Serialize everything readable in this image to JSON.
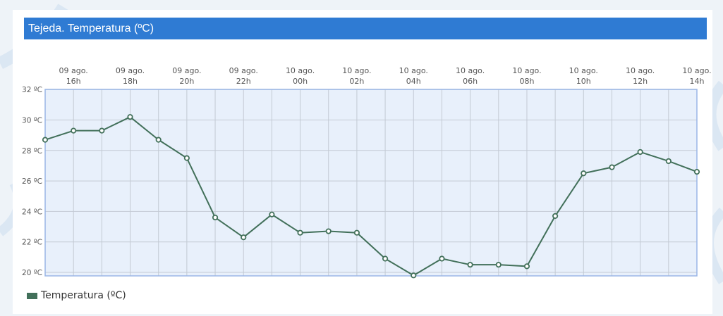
{
  "title": "Tejeda. Temperatura (ºC)",
  "colors": {
    "header": "#2f7bd3",
    "line": "#42705a",
    "plot_bg": "#e8f0fb",
    "plot_border": "#9ab6e6",
    "grid": "#c3cad4"
  },
  "legend": {
    "label": "Temperatura (ºC)"
  },
  "chart_data": {
    "type": "line",
    "x_ticks": [
      [
        "09 ago.",
        "16h"
      ],
      [
        "09 ago.",
        "18h"
      ],
      [
        "09 ago.",
        "20h"
      ],
      [
        "09 ago.",
        "22h"
      ],
      [
        "10 ago.",
        "00h"
      ],
      [
        "10 ago.",
        "02h"
      ],
      [
        "10 ago.",
        "04h"
      ],
      [
        "10 ago.",
        "06h"
      ],
      [
        "10 ago.",
        "08h"
      ],
      [
        "10 ago.",
        "10h"
      ],
      [
        "10 ago.",
        "12h"
      ],
      [
        "10 ago.",
        "14h"
      ]
    ],
    "y_ticks": [
      "20 ºC",
      "22 ºC",
      "24 ºC",
      "26 ºC",
      "28 ºC",
      "30 ºC",
      "32 ºC"
    ],
    "ylim": [
      19.8,
      32
    ],
    "grid": true,
    "legend_position": "bottom-left",
    "series": [
      {
        "name": "Temperatura (ºC)",
        "x": [
          "09 ago. 15h",
          "09 ago. 16h",
          "09 ago. 17h",
          "09 ago. 18h",
          "09 ago. 19h",
          "09 ago. 20h",
          "09 ago. 21h",
          "09 ago. 22h",
          "09 ago. 23h",
          "10 ago. 00h",
          "10 ago. 01h",
          "10 ago. 02h",
          "10 ago. 03h",
          "10 ago. 04h",
          "10 ago. 05h",
          "10 ago. 06h",
          "10 ago. 07h",
          "10 ago. 08h",
          "10 ago. 09h",
          "10 ago. 10h",
          "10 ago. 11h",
          "10 ago. 12h",
          "10 ago. 13h",
          "10 ago. 14h"
        ],
        "values": [
          28.7,
          29.3,
          29.3,
          30.2,
          28.7,
          27.5,
          23.6,
          22.3,
          23.8,
          22.6,
          22.7,
          22.6,
          20.9,
          19.8,
          20.9,
          20.5,
          20.5,
          20.4,
          23.7,
          26.5,
          26.9,
          27.9,
          27.3,
          26.6
        ]
      }
    ]
  }
}
